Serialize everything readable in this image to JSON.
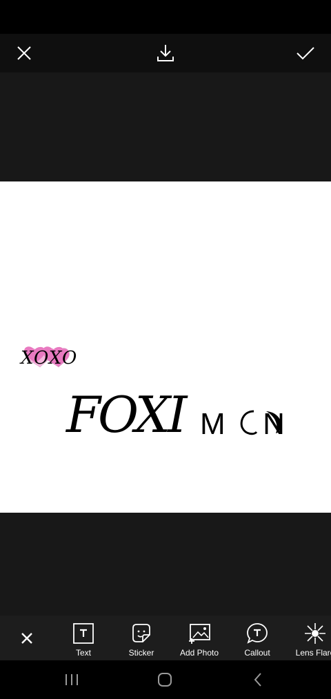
{
  "toolbar": {
    "tools": [
      {
        "label": "Text",
        "icon": "text-icon"
      },
      {
        "label": "Sticker",
        "icon": "sticker-icon"
      },
      {
        "label": "Add Photo",
        "icon": "add-photo-icon"
      },
      {
        "label": "Callout",
        "icon": "callout-icon"
      },
      {
        "label": "Lens Flare",
        "icon": "lens-flare-icon"
      }
    ]
  },
  "artwork": {
    "xoxo": "XOXO",
    "script_text": "FOXI",
    "moon_text": "M  N"
  },
  "colors": {
    "accent_pink": "#e87ac0",
    "canvas_bg": "#181818",
    "toolbar_bg": "#1d1d1d"
  }
}
